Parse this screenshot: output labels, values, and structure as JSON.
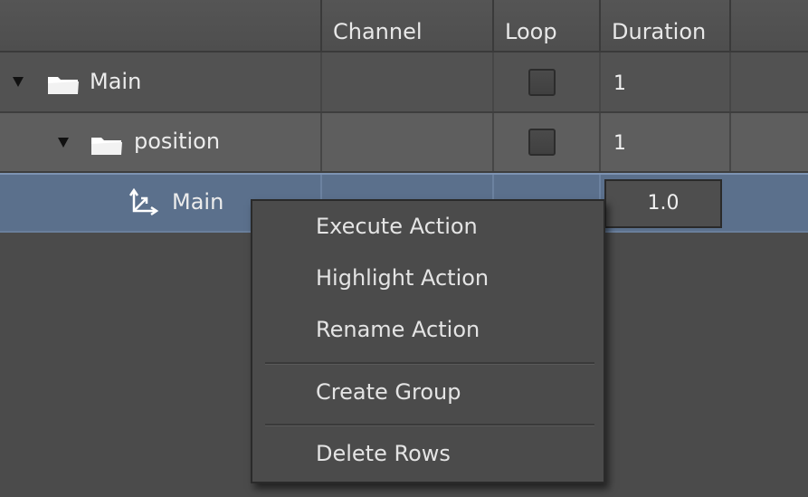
{
  "header": {
    "columns": [
      "",
      "Channel",
      "Loop",
      "Duration",
      ""
    ]
  },
  "rows": [
    {
      "label": "Main",
      "type": "group",
      "expanded": true,
      "loop_checked": false,
      "duration": "1"
    },
    {
      "label": "position",
      "type": "group",
      "expanded": true,
      "loop_checked": false,
      "duration": "1"
    },
    {
      "label": "Main",
      "type": "action",
      "selected": true,
      "channel_color": "#0b9a14",
      "duration": "1.0"
    }
  ],
  "context_menu": {
    "items": [
      {
        "label": "Execute Action"
      },
      {
        "label": "Highlight Action"
      },
      {
        "label": "Rename Action"
      },
      {
        "label": "Create Group"
      },
      {
        "label": "Delete Rows"
      }
    ]
  },
  "colors": {
    "background": "#4b4b4b",
    "selection": "#5b708c",
    "channel_green": "#0b9a14"
  }
}
